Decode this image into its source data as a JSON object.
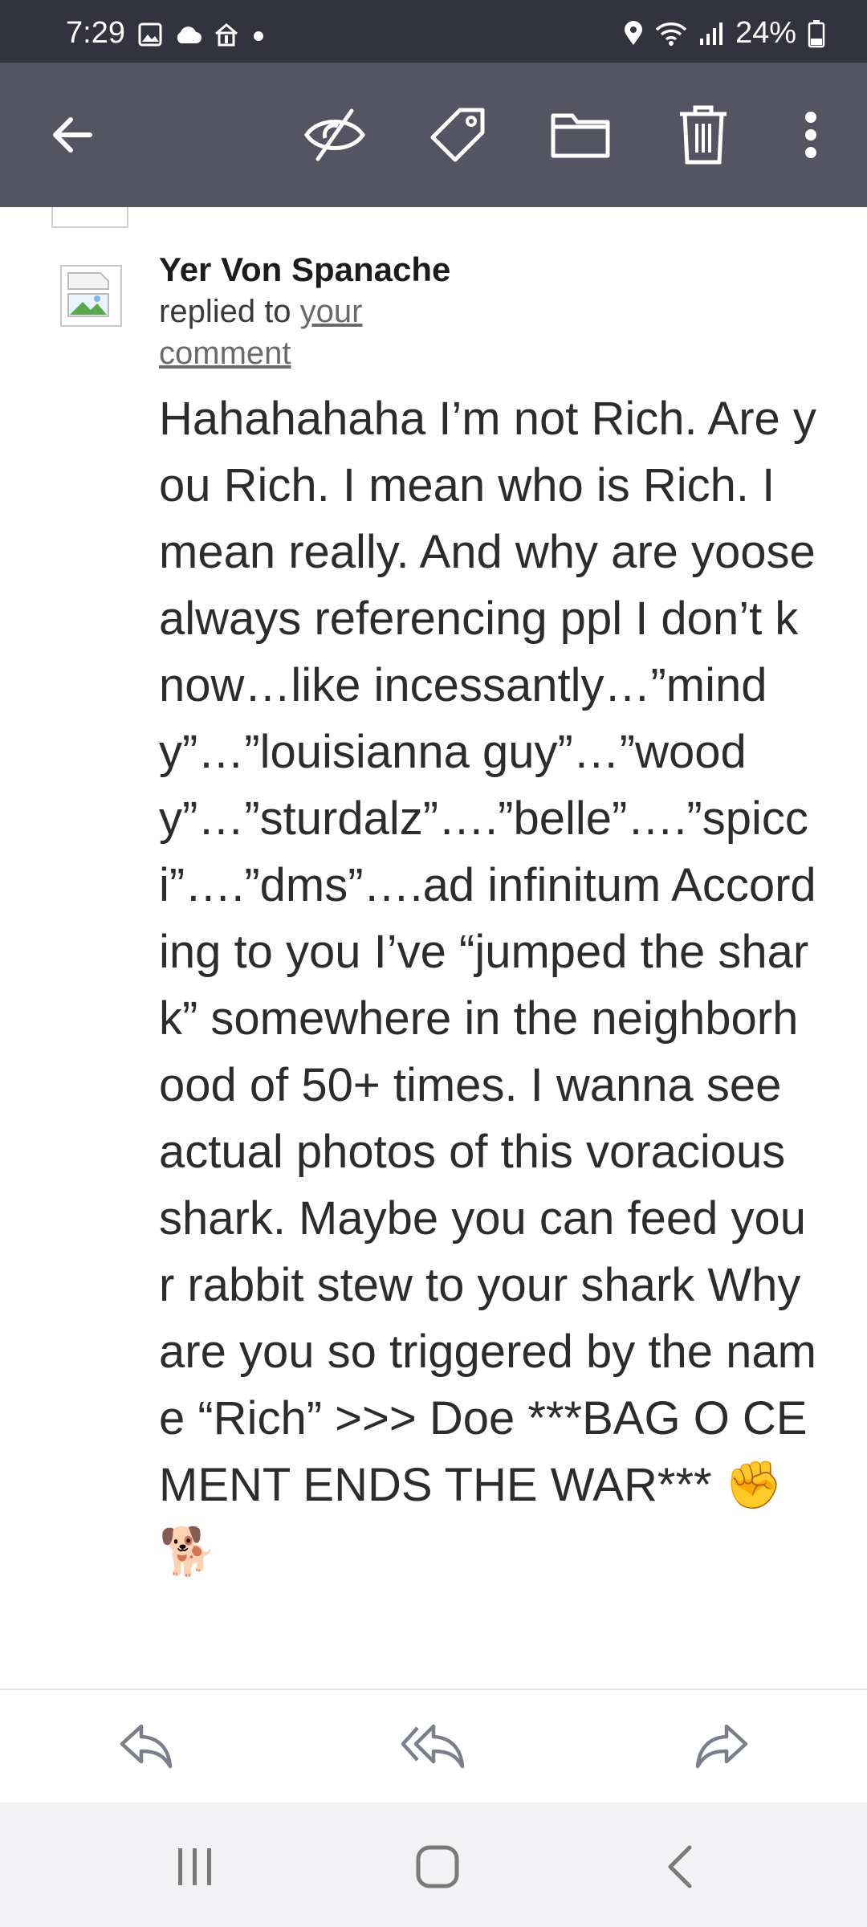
{
  "status_bar": {
    "time": "7:29",
    "battery": "24%",
    "icons": [
      "gallery-icon",
      "cloud-icon",
      "home-alert-icon",
      "dot-icon",
      "location-icon",
      "wifi-icon",
      "signal-icon",
      "battery-icon"
    ]
  },
  "toolbar": {
    "icons": [
      "back-arrow-icon",
      "hide-eye-icon",
      "tag-icon",
      "folder-icon",
      "trash-icon",
      "more-vert-icon"
    ]
  },
  "message": {
    "author": "Yer Von Spanache",
    "replied_prefix": "replied to ",
    "replied_link": "your comment",
    "body": "Hahahahaha I’m not Rich. Are you Rich. I mean who is Rich. I mean really. And why are yoose always referencing ppl I don’t know…like incessantly…”mindy”…”louisianna guy”…”woody”…”sturdalz”….”belle”….”spicci”….”dms”….ad infinitum According to you I’ve “jumped the shark” somewhere in the neighborhood of 50+ times. I wanna see actual photos of this voracious shark. Maybe you can feed your rabbit stew to your shark Why are you so triggered by the name “Rich” >>> Doe ***BAG O CEMENT ENDS THE WAR*** ✊🐕"
  },
  "action_bar": {
    "icons": [
      "reply-icon",
      "reply-all-icon",
      "forward-icon"
    ]
  },
  "nav_bar": {
    "icons": [
      "recents-icon",
      "home-icon",
      "back-icon"
    ]
  },
  "colors": {
    "status_bg": "#333340",
    "toolbar_bg": "#545463",
    "text": "#2c2c2c",
    "icon_gray": "#7a7f8a"
  }
}
